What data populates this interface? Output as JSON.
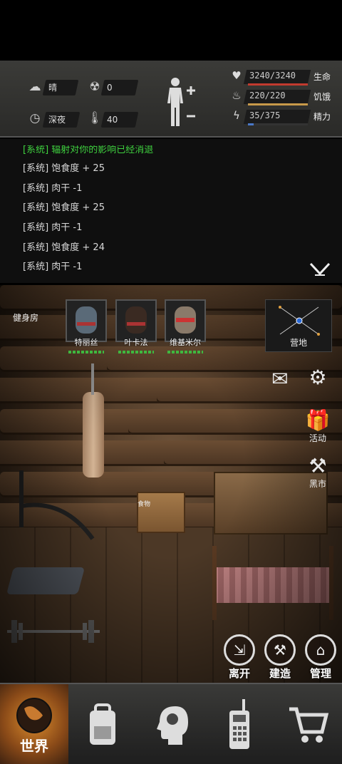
{
  "status": {
    "weather": "晴",
    "radiation": "0",
    "time_of_day": "深夜",
    "temperature": "40"
  },
  "vitals": [
    {
      "label": "生命",
      "value": "3240/3240",
      "fill": 1.0,
      "color": "#c23a2e",
      "icon": "heart-icon"
    },
    {
      "label": "饥饿",
      "value": "220/220",
      "fill": 1.0,
      "color": "#c89a4a",
      "icon": "stomach-icon"
    },
    {
      "label": "精力",
      "value": "35/375",
      "fill": 0.093,
      "color": "#4a78c8",
      "icon": "energy-icon"
    }
  ],
  "log": [
    {
      "text": "[系统] 辐射对你的影响已经消退",
      "color": "green"
    },
    {
      "text": "[系统] 饱食度 + 25",
      "color": "white"
    },
    {
      "text": "[系统] 肉干 -1",
      "color": "white"
    },
    {
      "text": "[系统] 饱食度 + 25",
      "color": "white"
    },
    {
      "text": "[系统] 肉干 -1",
      "color": "white"
    },
    {
      "text": "[系统] 饱食度 + 24",
      "color": "white"
    },
    {
      "text": "[系统] 肉干 -1",
      "color": "white"
    }
  ],
  "room": {
    "name": "健身房",
    "food_box_label": "食物"
  },
  "companions": [
    {
      "name": "特丽丝"
    },
    {
      "name": "叶卡法"
    },
    {
      "name": "维基米尔"
    }
  ],
  "map_button": {
    "label": "营地"
  },
  "side_buttons": {
    "activity": "活动",
    "black_market": "黑市"
  },
  "actions": {
    "leave": "离开",
    "build": "建造",
    "manage": "管理"
  },
  "nav": {
    "world": "世界"
  }
}
